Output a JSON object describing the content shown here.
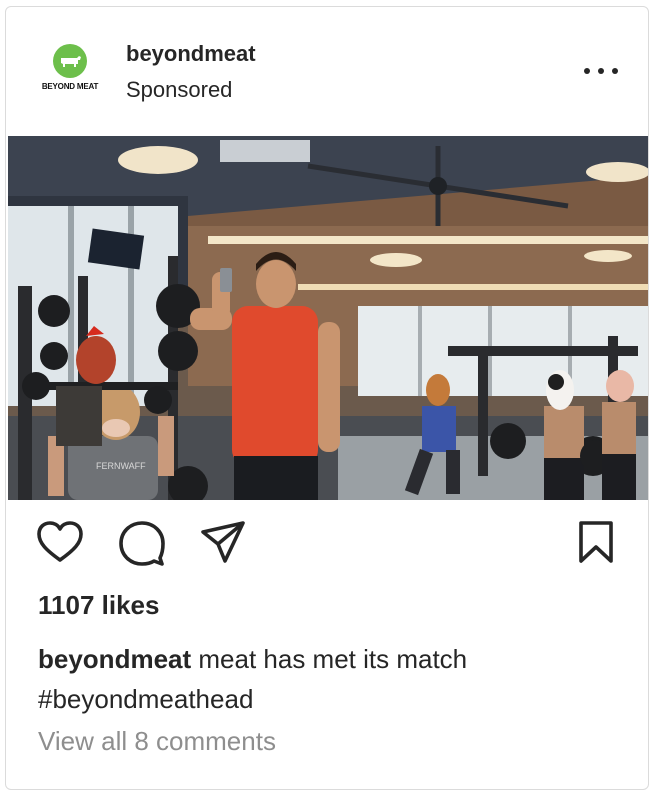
{
  "post": {
    "username": "beyondmeat",
    "subtitle": "Sponsored",
    "avatar_wordmark": "BEYOND MEAT",
    "likes": "1107 likes",
    "caption_username": "beyondmeat",
    "caption_text": " meat has met its match",
    "caption_hashtag": "#beyondmeathead",
    "view_comments": "View all 8 comments",
    "shirt_text": "FERNWAFF"
  },
  "icons": {
    "more": "more-dots-icon",
    "like": "heart-icon",
    "comment": "comment-bubble-icon",
    "share": "paper-plane-icon",
    "save": "bookmark-icon"
  },
  "colors": {
    "brand_green": "#6dbf4b",
    "text": "#262626",
    "muted": "#8e8e8e",
    "border": "#dbdbdb"
  }
}
